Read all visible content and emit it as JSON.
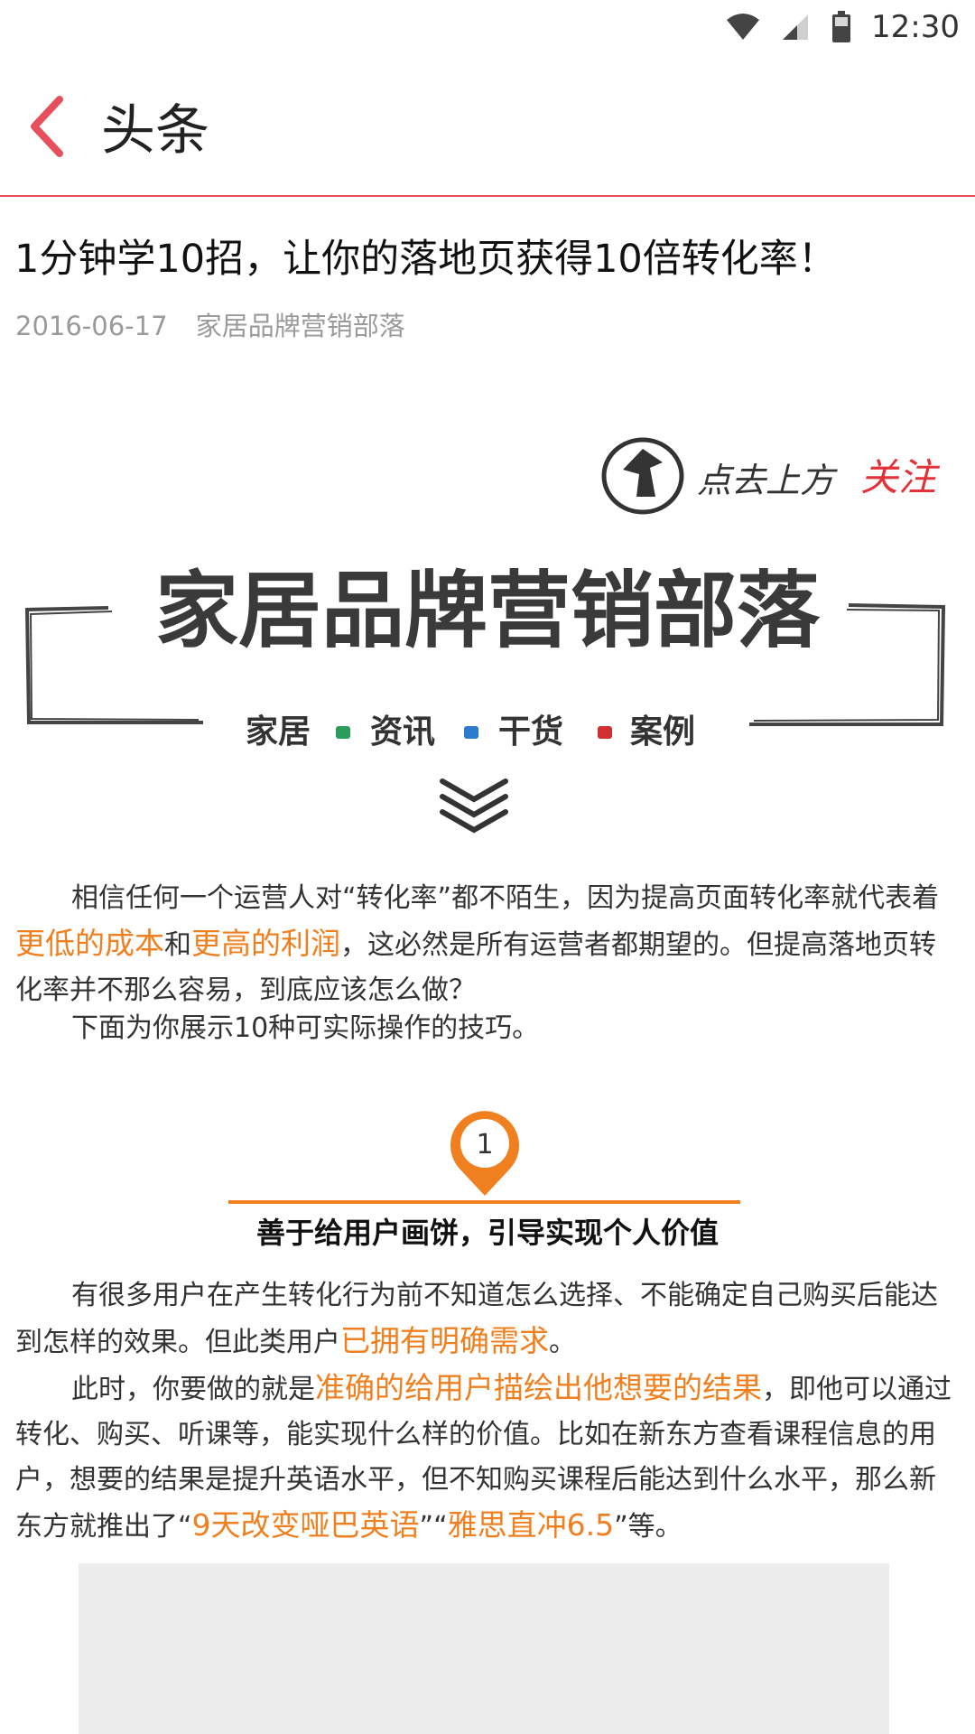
{
  "status_bar": {
    "time": "12:30",
    "icons": [
      "wifi-icon",
      "signal-icon",
      "battery-icon"
    ]
  },
  "app_bar": {
    "title": "头条",
    "back_icon": "chevron-left-icon"
  },
  "colors": {
    "accent": "#e5505b",
    "highlight": "#f07f1f",
    "meta": "#9a9a9a"
  },
  "article": {
    "title": "1分钟学10招，让你的落地页获得10倍转化率！",
    "date": "2016-06-17",
    "author": "家居品牌营销部落",
    "banner": {
      "follow_prefix": "点去上方",
      "follow_highlight": "关注",
      "brand_name": "家居品牌营销部落",
      "tags": [
        "家居",
        "资讯",
        "干货",
        "案例"
      ]
    },
    "intro": {
      "p1_a": "相信任何一个运营人对“转化率”都不陌生，因为提高页面转化率就代表着",
      "p1_hl1": "更低的成本",
      "p1_b": "和",
      "p1_hl2": "更高的利润",
      "p1_c": "，这必然是所有运营者都期望的。但提高落地页转化率并不那么容易，到底应该怎么做？",
      "p2": "下面为你展示10种可实际操作的技巧。"
    },
    "section1": {
      "number": "1",
      "title": "善于给用户画饼，引导实现个人价值",
      "p1_a": "有很多用户在产生转化行为前不知道怎么选择、不能确定自己购买后能达到怎样的效果。但此类用户",
      "p1_hl": "已拥有明确需求",
      "p1_b": "。",
      "p2_a": "此时，你要做的就是",
      "p2_hl1": "准确的给用户描绘出他想要的结果",
      "p2_b": "，即他可以通过转化、购买、听课等，能实现什么样的价值。比如在新东方查看课程信息的用户，想要的结果是提升英语水平，但不知购买课程后能达到什么水平，那么新东方就推出了“",
      "p2_hl2": "9天改变哑巴英语",
      "p2_c": "”“",
      "p2_hl3": "雅思直冲6.5",
      "p2_d": "”等。"
    }
  }
}
